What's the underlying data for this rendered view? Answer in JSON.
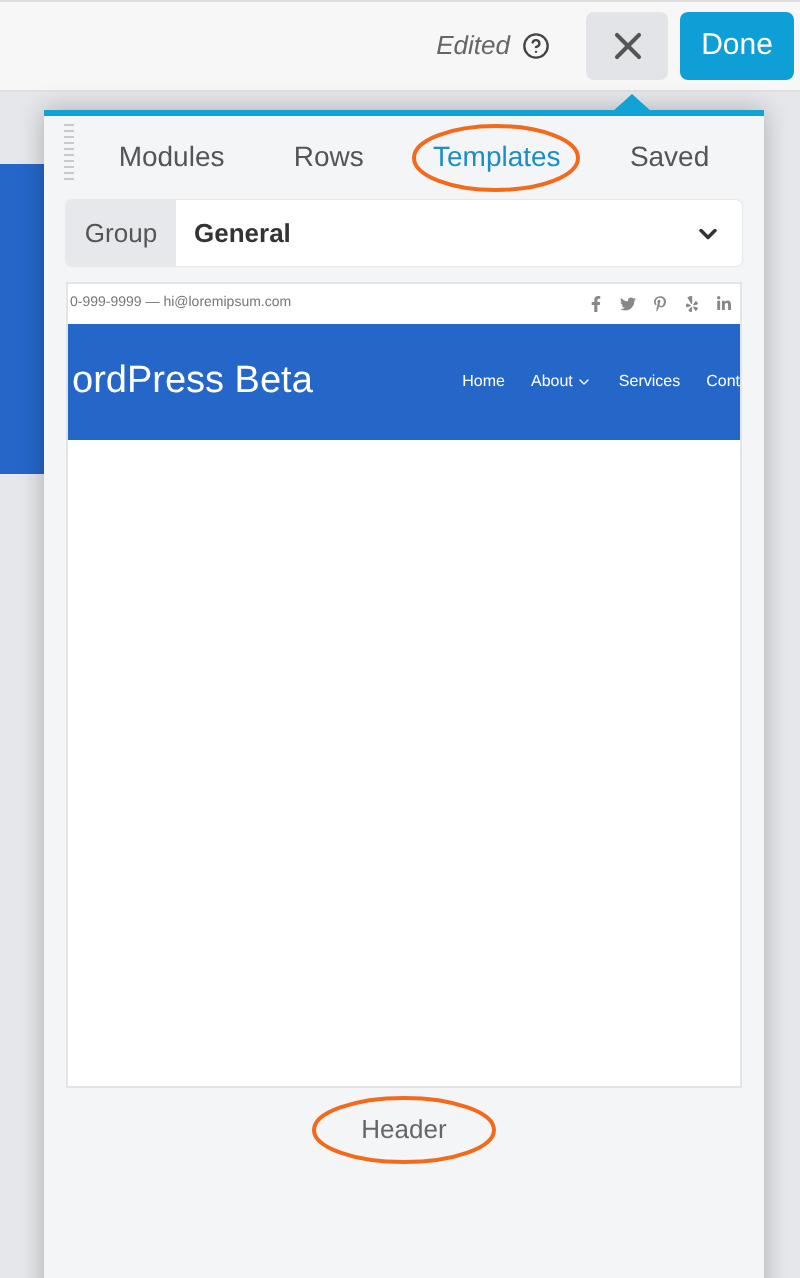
{
  "topbar": {
    "status": "Edited",
    "done_button": "Done"
  },
  "tabs": [
    {
      "label": "Modules",
      "selected": false,
      "circled": false
    },
    {
      "label": "Rows",
      "selected": false,
      "circled": false
    },
    {
      "label": "Templates",
      "selected": true,
      "circled": true
    },
    {
      "label": "Saved",
      "selected": false,
      "circled": false
    }
  ],
  "group_select": {
    "label": "Group",
    "value": "General"
  },
  "template": {
    "contact": "0-999-9999 — hi@loremipsum.com",
    "site_title": "ordPress Beta",
    "nav": [
      {
        "label": "Home",
        "dropdown": false
      },
      {
        "label": "About",
        "dropdown": true
      },
      {
        "label": "Services",
        "dropdown": false
      },
      {
        "label": "Cont",
        "dropdown": false
      }
    ],
    "name": "Header",
    "circled": true
  }
}
